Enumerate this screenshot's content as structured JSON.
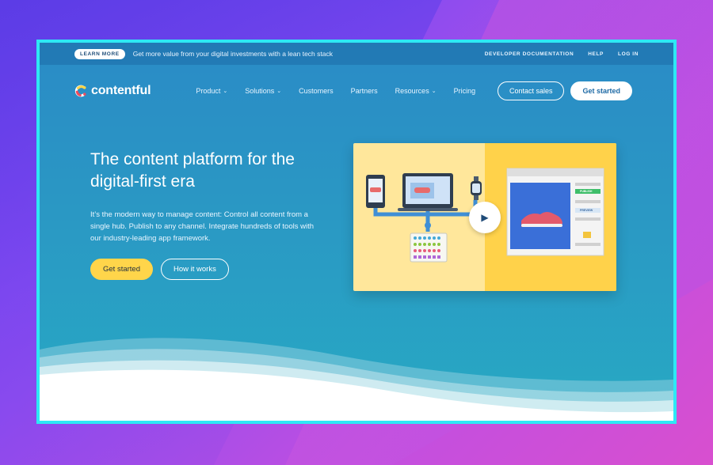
{
  "topbar": {
    "badge": "LEARN MORE",
    "promo": "Get more value from your digital investments with a lean tech stack",
    "links": [
      "DEVELOPER DOCUMENTATION",
      "HELP",
      "LOG IN"
    ]
  },
  "nav": {
    "logo_text": "contentful",
    "menu": [
      {
        "label": "Product",
        "dropdown": true
      },
      {
        "label": "Solutions",
        "dropdown": true
      },
      {
        "label": "Customers",
        "dropdown": false
      },
      {
        "label": "Partners",
        "dropdown": false
      },
      {
        "label": "Resources",
        "dropdown": true
      },
      {
        "label": "Pricing",
        "dropdown": false
      }
    ],
    "contact_sales": "Contact sales",
    "get_started": "Get started"
  },
  "hero": {
    "title": "The content platform for the digital-first era",
    "description": "It’s the modern way to manage content: Control all content from a single hub. Publish to any channel. Integrate hundreds of tools with our industry-leading app framework.",
    "primary_cta": "Get started",
    "secondary_cta": "How it works"
  },
  "video": {
    "publish_label": "PUBLISH",
    "preview_label": "PREVIEW",
    "play_icon": "play-icon"
  },
  "colors": {
    "frame_border": "#2ee8f5",
    "hero_bg": "#2a8bc6",
    "cta_yellow": "#ffd54a",
    "video_left": "#ffe79b",
    "video_right": "#ffd24a"
  }
}
